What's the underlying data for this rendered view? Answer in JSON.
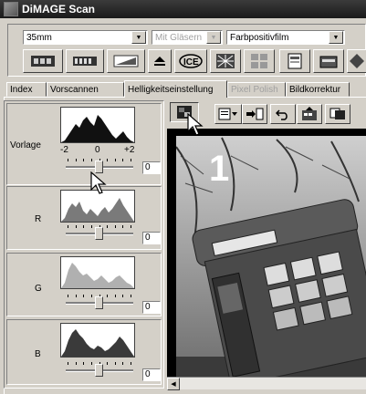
{
  "window": {
    "title": "DiMAGE Scan"
  },
  "toolbar": {
    "film_type": "35mm",
    "glass_mount": "Mit Gläsern",
    "film_mode": "Farbpositivfilm"
  },
  "tabs": [
    {
      "label": "Index"
    },
    {
      "label": "Vorscannen"
    },
    {
      "label": "Helligkeitseinstellung"
    },
    {
      "label": "Pixel Polish"
    },
    {
      "label": "Bildkorrektur"
    }
  ],
  "panels": {
    "vorlage": {
      "label": "Vorlage",
      "scale_min": "-2",
      "scale_mid": "0",
      "scale_max": "+2",
      "value": "0"
    },
    "r": {
      "label": "R",
      "value": "0"
    },
    "g": {
      "label": "G",
      "value": "0"
    },
    "b": {
      "label": "B",
      "value": "0"
    }
  },
  "preview": {
    "frame_number": "1"
  },
  "colors": {
    "titlebar": "#222222",
    "face": "#d4d0c8",
    "red_channel": "#7a7a7a",
    "green_channel": "#b0b0b0",
    "blue_channel": "#3a3a3a"
  }
}
